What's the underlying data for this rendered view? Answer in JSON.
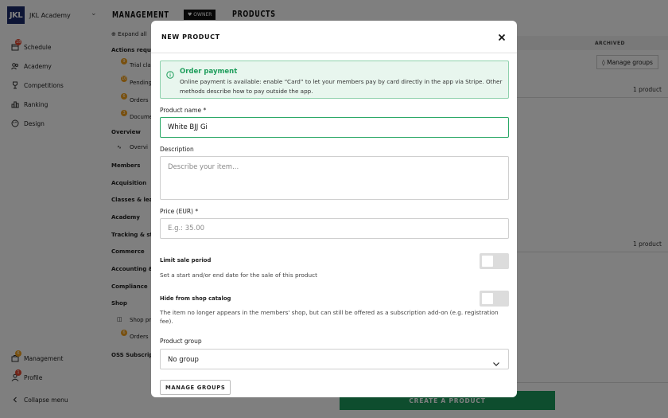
{
  "sidebar": {
    "logo_text": "JKL",
    "brand_name": "JKL Academy",
    "items": [
      {
        "label": "Schedule",
        "badge": "18"
      },
      {
        "label": "Academy"
      },
      {
        "label": "Competitions"
      },
      {
        "label": "Ranking"
      },
      {
        "label": "Design"
      }
    ],
    "bottom_items": [
      {
        "label": "Management",
        "badge": "6"
      },
      {
        "label": "Profile",
        "badge": "1"
      }
    ],
    "collapse_label": "Collapse menu"
  },
  "subnav": {
    "expand_all": "Expand all",
    "sections": [
      {
        "label": "Actions requir"
      },
      {
        "label": "Trial cla",
        "badge": "9"
      },
      {
        "label": "Pending",
        "badge": "10"
      },
      {
        "label": "Orders",
        "badge": "6"
      },
      {
        "label": "Docume",
        "badge": "3"
      },
      {
        "label": "Overview"
      },
      {
        "label": "Overvi"
      },
      {
        "label": "Members"
      },
      {
        "label": "Acquisition"
      },
      {
        "label": "Classes & lear"
      },
      {
        "label": "Academy"
      },
      {
        "label": "Tracking & sta"
      },
      {
        "label": "Commerce"
      },
      {
        "label": "Accounting & "
      },
      {
        "label": "Compliance"
      },
      {
        "label": "Shop"
      },
      {
        "label": "Shop pr"
      },
      {
        "label": "Orders",
        "badge": "6"
      },
      {
        "label": "OSS Subscript"
      }
    ]
  },
  "header": {
    "management": "MANAGEMENT",
    "owner": "OWNER",
    "products": "PRODUCTS",
    "archived": "ARCHIVED",
    "manage_groups": "Manage groups",
    "count1": "1 product",
    "count2": "1 product",
    "create_button": "CREATE A PRODUCT"
  },
  "modal": {
    "title": "NEW PRODUCT",
    "alert": {
      "title": "Order payment",
      "body": "Online payment is available: enable “Card” to let your members pay by card directly in the app via Stripe. Other methods describe how to pay outside the app."
    },
    "product_name": {
      "label": "Product name *",
      "value": "White BJJ Gi"
    },
    "description": {
      "label": "Description",
      "placeholder": "Describe your item..."
    },
    "price": {
      "label": "Price (EUR) *",
      "placeholder": "E.g.: 35.00"
    },
    "limit_sale": {
      "label": "Limit sale period",
      "help": "Set a start and/or end date for the sale of this product",
      "enabled": false
    },
    "hide_catalog": {
      "label": "Hide from shop catalog",
      "help": "The item no longer appears in the members' shop, but can still be offered as a subscription add-on (e.g. registration fee).",
      "enabled": false
    },
    "product_group": {
      "label": "Product group",
      "value": "No group"
    },
    "manage_groups_button": "MANAGE GROUPS"
  },
  "colors": {
    "brand_navy": "#1b2a6b",
    "accent_green": "#1f9e5c",
    "badge_red": "#e2462e",
    "badge_orange": "#f2a01c"
  }
}
